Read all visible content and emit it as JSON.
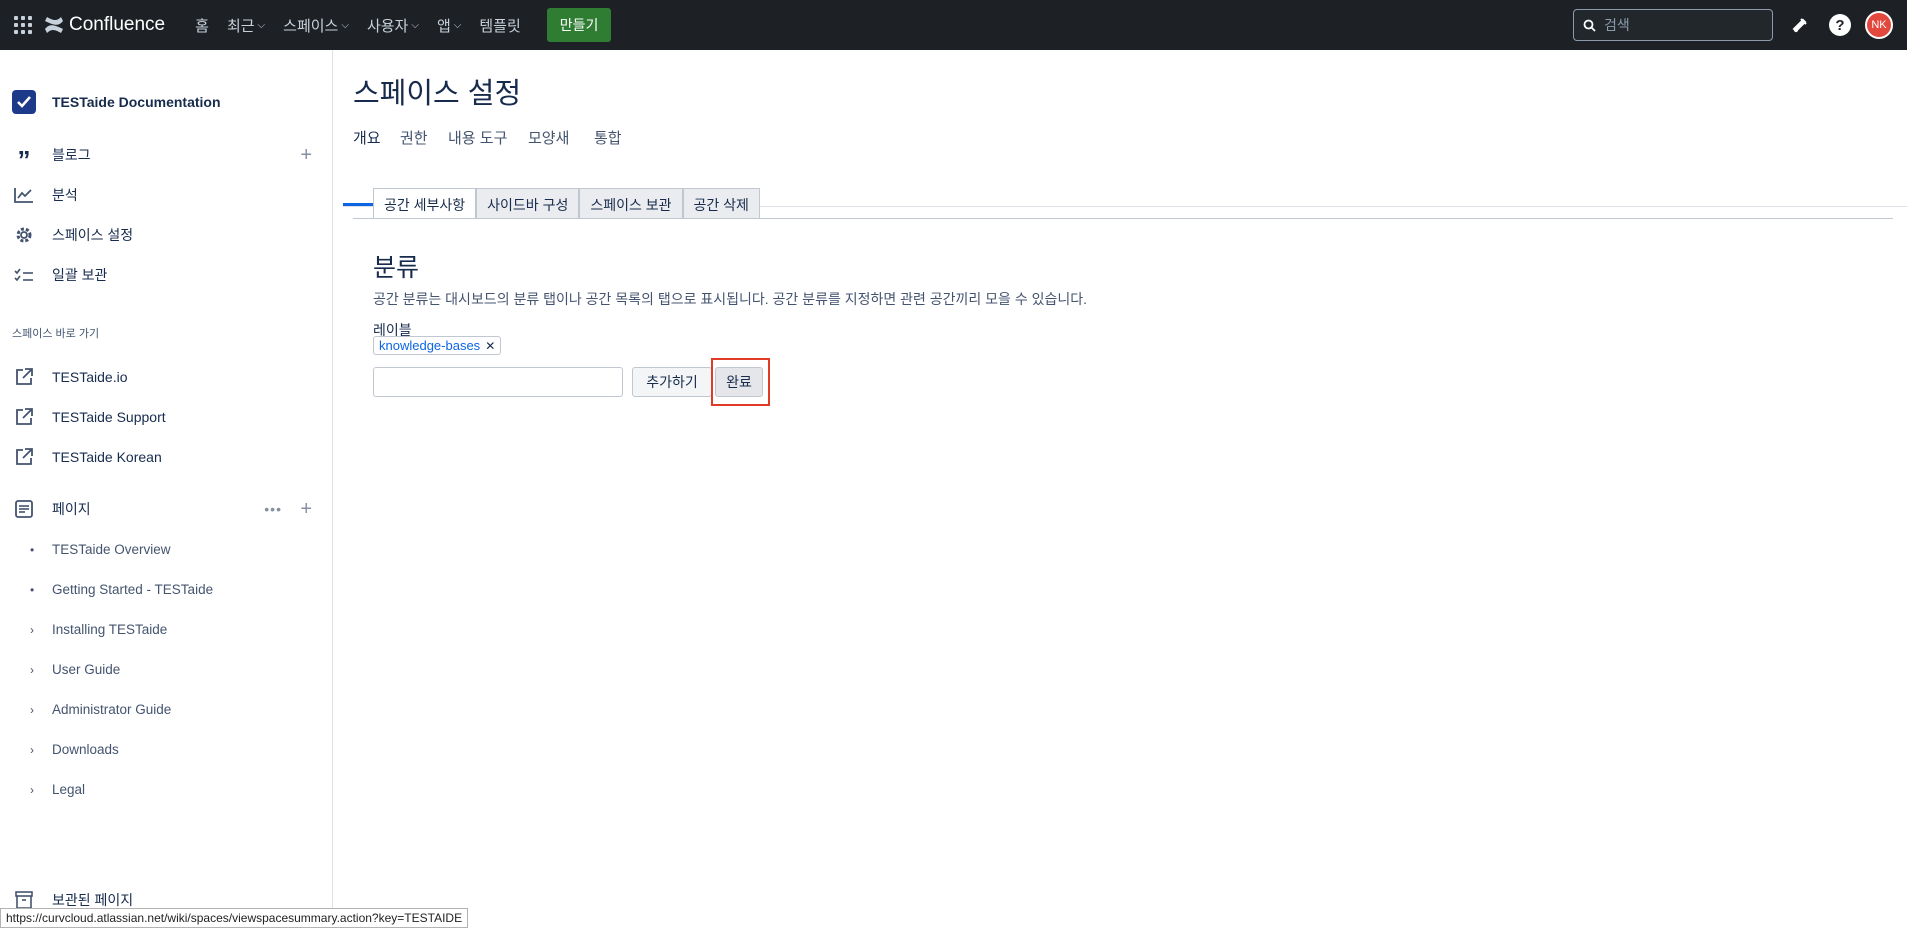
{
  "topnav": {
    "brand": "Confluence",
    "items": [
      {
        "label": "홈",
        "has_dropdown": false
      },
      {
        "label": "최근",
        "has_dropdown": true
      },
      {
        "label": "스페이스",
        "has_dropdown": true
      },
      {
        "label": "사용자",
        "has_dropdown": true
      },
      {
        "label": "앱",
        "has_dropdown": true
      },
      {
        "label": "템플릿",
        "has_dropdown": false
      }
    ],
    "create_label": "만들기",
    "search_placeholder": "검색",
    "avatar_initials": "NK"
  },
  "sidebar": {
    "space_name": "TESTaide Documentation",
    "items": [
      {
        "label": "블로그",
        "icon": "quote-icon"
      },
      {
        "label": "분석",
        "icon": "analytics-icon"
      },
      {
        "label": "스페이스 설정",
        "icon": "gear-icon"
      },
      {
        "label": "일괄 보관",
        "icon": "bulk-archive-icon"
      }
    ],
    "shortcuts_title": "스페이스 바로 가기",
    "shortcuts": [
      "TESTaide.io",
      "TESTaide Support",
      "TESTaide Korean"
    ],
    "pages_label": "페이지",
    "tree": [
      {
        "label": "TESTaide Overview",
        "type": "bullet"
      },
      {
        "label": "Getting Started - TESTaide",
        "type": "bullet"
      },
      {
        "label": "Installing TESTaide",
        "type": "expand"
      },
      {
        "label": "User Guide",
        "type": "expand"
      },
      {
        "label": "Administrator Guide",
        "type": "expand"
      },
      {
        "label": "Downloads",
        "type": "expand"
      },
      {
        "label": "Legal",
        "type": "expand"
      }
    ],
    "archived_label": "보관된 페이지"
  },
  "status_url": "https://curvcloud.atlassian.net/wiki/spaces/viewspacesummary.action?key=TESTAIDE",
  "main": {
    "title": "스페이스 설정",
    "tabs": [
      "개요",
      "권한",
      "내용 도구",
      "모양새",
      "통합"
    ],
    "active_tab": "개요",
    "subtabs": [
      "공간 세부사항",
      "사이드바 구성",
      "스페이스 보관",
      "공간 삭제"
    ],
    "active_subtab": "공간 세부사항",
    "section_title": "분류",
    "section_desc": "공간 분류는 대시보드의 분류 탭이나 공간 목록의 탭으로 표시됩니다. 공간 분류를 지정하면 관련 공간끼리 모을 수 있습니다.",
    "label_title": "레이블",
    "labels": [
      "knowledge-bases"
    ],
    "input_value": "",
    "add_button": "추가하기",
    "done_button": "완료"
  },
  "colors": {
    "topnav_bg": "#1d2125",
    "create_bg": "#2e7d32",
    "accent": "#0c66e4",
    "highlight": "#e03b24"
  }
}
